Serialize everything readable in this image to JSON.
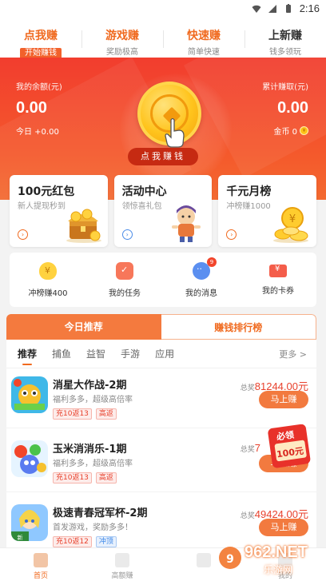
{
  "status_bar": {
    "time": "2:16",
    "icons": [
      "wifi-icon",
      "signal-icon",
      "battery-icon"
    ]
  },
  "top_tabs": [
    {
      "title": "点我赚",
      "sub": "开始赚钱",
      "active": true
    },
    {
      "title": "游戏赚",
      "sub": "奖励极高"
    },
    {
      "title": "快速赚",
      "sub": "简单快速"
    },
    {
      "title": "上新赚",
      "sub": "钱多领玩"
    }
  ],
  "hero": {
    "balance_label": "我的余额(元)",
    "balance_value": "0.00",
    "today_text": "今日 +0.00",
    "total_label": "累计赚取(元)",
    "total_value": "0.00",
    "gold_label": "金币 0",
    "cta": "点我赚钱"
  },
  "cards": [
    {
      "title": "100元红包",
      "sub": "新人提现秒到"
    },
    {
      "title": "活动中心",
      "sub": "领惊喜礼包"
    },
    {
      "title": "千元月榜",
      "sub": "冲榜赚1000"
    }
  ],
  "quick_links": [
    {
      "label": "冲榜赚400",
      "icon": "coin-bag-icon"
    },
    {
      "label": "我的任务",
      "icon": "task-icon"
    },
    {
      "label": "我的消息",
      "icon": "message-icon",
      "badge": "9"
    },
    {
      "label": "我的卡券",
      "icon": "coupon-icon"
    }
  ],
  "rank_tabs": {
    "today": "今日推荐",
    "rank": "赚钱排行榜"
  },
  "categories": [
    "推荐",
    "捕鱼",
    "益智",
    "手游",
    "应用"
  ],
  "more_label": "更多 >",
  "games": [
    {
      "name": "消星大作战-2期",
      "desc": "福利多多，超级高倍率",
      "tags": [
        "充10返13",
        "高返"
      ],
      "prize_label": "总奖",
      "prize": "81244.00元",
      "button": "马上赚"
    },
    {
      "name": "玉米消消乐-1期",
      "desc": "福利多多，超级高倍率",
      "tags": [
        "充10返13",
        "高返"
      ],
      "prize_label": "总奖",
      "prize": "7",
      "button": "马上赚"
    },
    {
      "name": "极速青春冠军杯-2期",
      "desc": "首发游戏，奖励多多！",
      "tags": [
        "充10返12",
        "冲顶"
      ],
      "prize_label": "总奖",
      "prize": "49424.00元",
      "button": "马上赚"
    }
  ],
  "float_coupon": {
    "line1": "必领",
    "line2": "100元"
  },
  "bottom_nav": [
    {
      "label": "首页",
      "active": true
    },
    {
      "label": "高额赚"
    },
    {
      "label": ""
    },
    {
      "label": "我的"
    }
  ],
  "watermark": {
    "text": "962.NET",
    "sub": "乐游网"
  },
  "colors": {
    "accent": "#f06a1f",
    "hero_red": "#f23d2e",
    "prize_red": "#e8412c"
  }
}
